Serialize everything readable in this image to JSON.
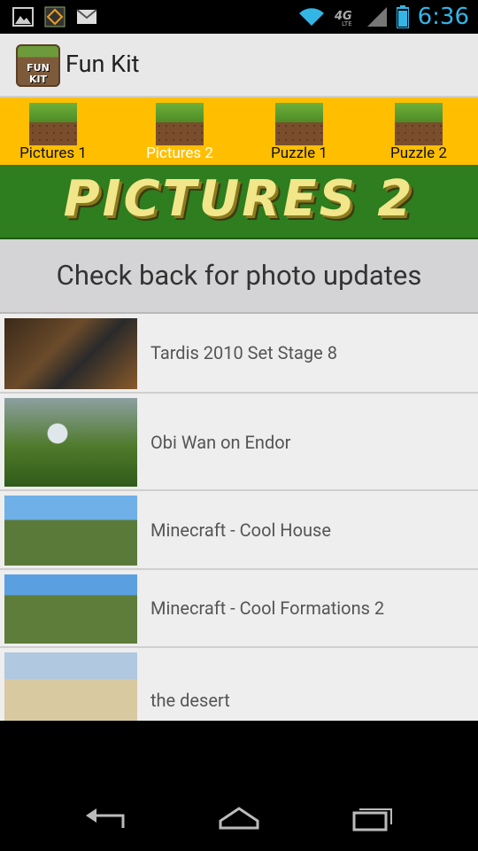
{
  "status": {
    "time": "6:36",
    "icons": [
      "image-icon",
      "app-notify-icon",
      "mail-icon",
      "wifi-icon",
      "4g-lte-icon",
      "signal-icon",
      "battery-icon"
    ]
  },
  "app": {
    "title": "Fun Kit",
    "icon_text": "FUN KIT"
  },
  "tabs": [
    {
      "label": "Pictures 1",
      "active": false
    },
    {
      "label": "Pictures 2",
      "active": true
    },
    {
      "label": "Puzzle 1",
      "active": false
    },
    {
      "label": "Puzzle 2",
      "active": false
    }
  ],
  "banner": {
    "text": "PICTURES 2"
  },
  "subheader": {
    "text": "Check back for photo updates"
  },
  "items": [
    {
      "title": "Tardis 2010 Set Stage 8"
    },
    {
      "title": "Obi Wan on Endor"
    },
    {
      "title": "Minecraft - Cool House"
    },
    {
      "title": "Minecraft - Cool Formations 2"
    },
    {
      "title": "the desert"
    }
  ],
  "colors": {
    "tab_bg": "#ffbf00",
    "banner_bg": "#2e7d1e",
    "status_time": "#33b5e5"
  }
}
